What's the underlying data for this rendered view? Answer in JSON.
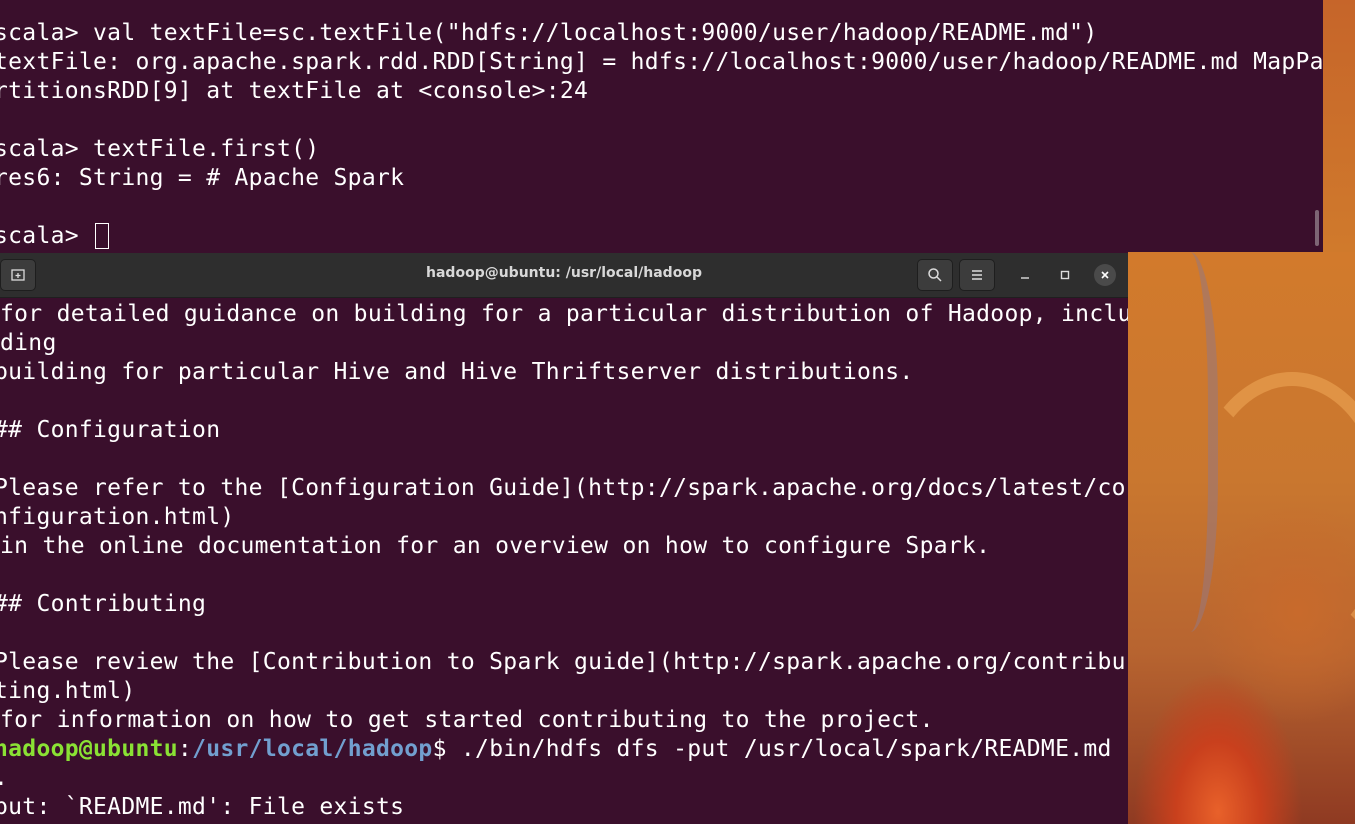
{
  "back_terminal": {
    "lines": [
      "scala> val textFile=sc.textFile(\"hdfs://localhost:9000/user/hadoop/README.md\")",
      "textFile: org.apache.spark.rdd.RDD[String] = hdfs://localhost:9000/user/hadoop/README.md MapPa",
      "rtitionsRDD[9] at textFile at <console>:24",
      "",
      "scala> textFile.first()",
      "res6: String = # Apache Spark",
      "",
      "scala> "
    ]
  },
  "front_terminal": {
    "title": "hadoop@ubuntu: /usr/local/hadoop",
    "lines": [
      "for detailed guidance on building for a particular distribution of Hadoop, inclu",
      "ding",
      "building for particular Hive and Hive Thriftserver distributions.",
      "",
      "## Configuration",
      "",
      "Please refer to the [Configuration Guide](http://spark.apache.org/docs/latest/co",
      "nfiguration.html)",
      "in the online documentation for an overview on how to configure Spark.",
      "",
      "## Contributing",
      "",
      "Please review the [Contribution to Spark guide](http://spark.apache.org/contribu",
      "ting.html)",
      "for information on how to get started contributing to the project."
    ],
    "prompt": {
      "user_host": "hadoop@ubuntu",
      "separator": ":",
      "path": "/usr/local/hadoop",
      "symbol": "$",
      "command": " ./bin/hdfs dfs -put /usr/local/spark/README.md"
    },
    "after_lines": [
      ".",
      "put: `README.md': File exists"
    ]
  }
}
